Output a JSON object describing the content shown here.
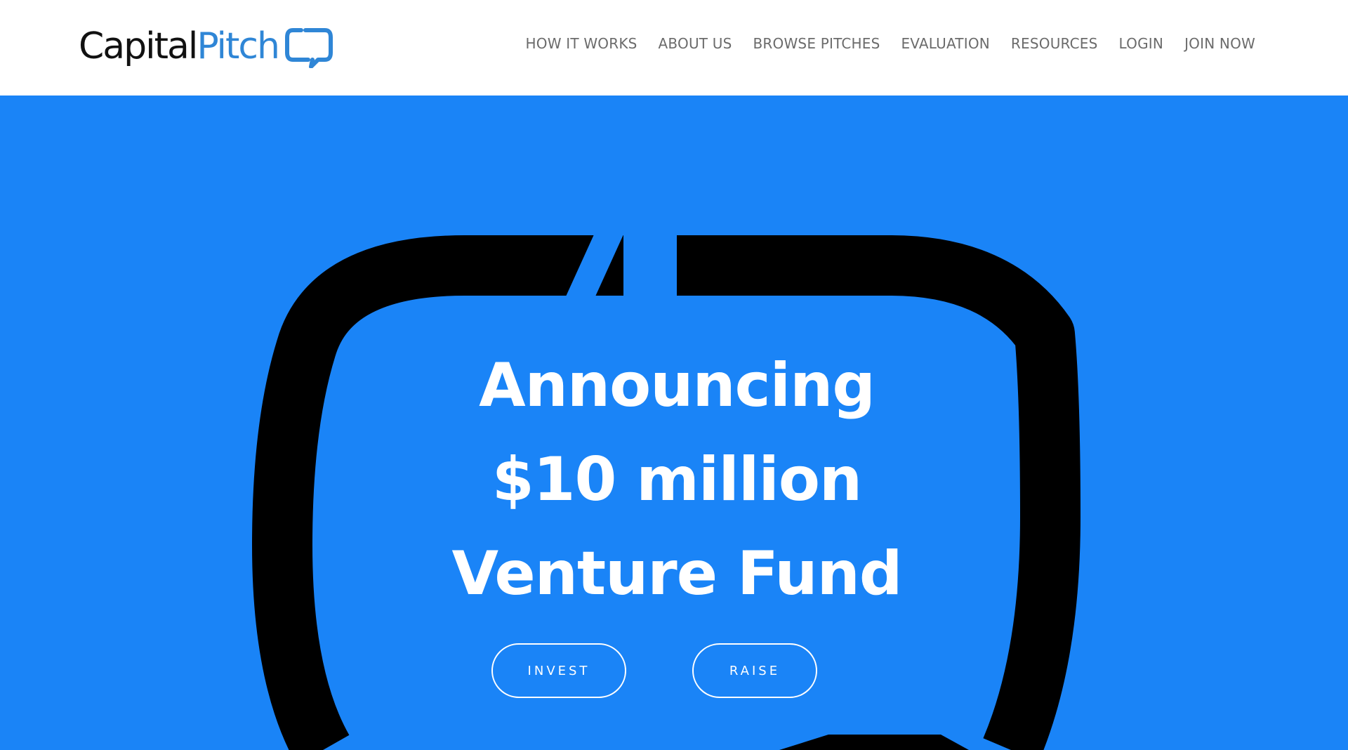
{
  "brand": {
    "name_part1": "Capital",
    "name_part2": "Pitch",
    "logo_icon": "speech-bubble-icon",
    "primary_color": "#1a84f7",
    "logo_accent_color": "#2f86d6"
  },
  "nav": {
    "items": [
      {
        "label": "HOW IT WORKS"
      },
      {
        "label": "ABOUT US"
      },
      {
        "label": "BROWSE PITCHES"
      },
      {
        "label": "EVALUATION"
      },
      {
        "label": "RESOURCES"
      },
      {
        "label": "LOGIN"
      },
      {
        "label": "JOIN NOW"
      }
    ]
  },
  "hero": {
    "headline_lines": [
      "Announcing",
      "$10 million",
      "Venture Fund"
    ],
    "background_color": "#1a84f7",
    "mark_icon": "speech-bubble-icon",
    "invest_label": "INVEST",
    "raise_label": "RAISE"
  }
}
